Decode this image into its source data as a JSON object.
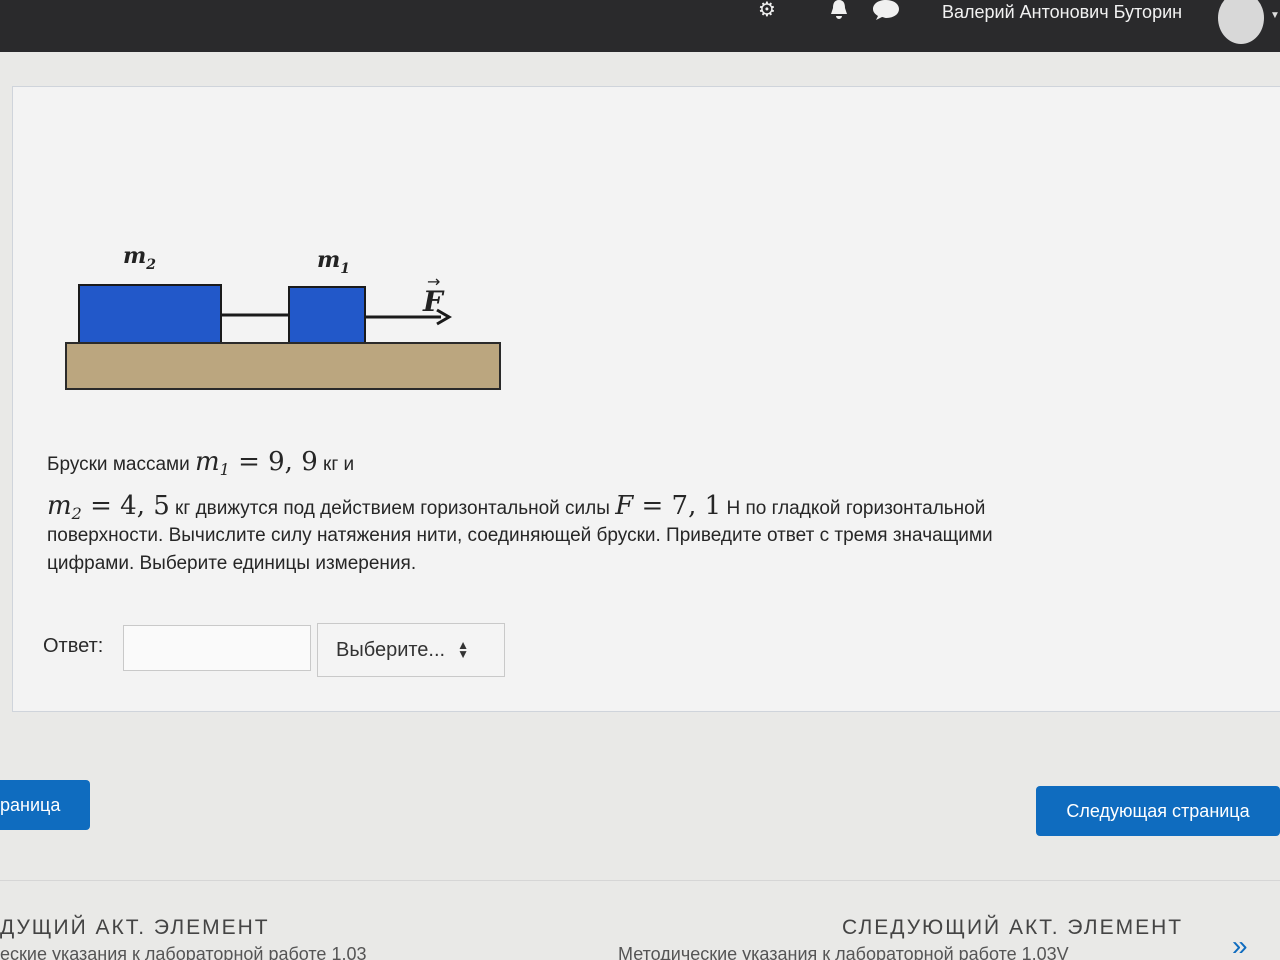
{
  "header": {
    "user_name": "Валерий Антонович Буторин",
    "icons": [
      "settings-icon",
      "bell-icon",
      "chat-icon"
    ]
  },
  "figure": {
    "label_m2_main": "m",
    "label_m2_sub": "2",
    "label_m1_main": "m",
    "label_m1_sub": "1",
    "label_force": "F",
    "label_force_arrow": "→",
    "colors": {
      "block": "#2258c9",
      "surface": "#bba67f"
    }
  },
  "question": {
    "line1_text": "Бруски массами ",
    "line1_math_var": "m",
    "line1_math_sub": "1",
    "line1_math_eq": " = 9, 9",
    "line1_unit": " кг и",
    "line2_math_var": "m",
    "line2_math_sub": "2",
    "line2_math_eq": " = 4, 5",
    "line2_text": " кг движутся под действием горизонтальной силы ",
    "line2_force_var": "F",
    "line2_force_eq": " = 7, 1",
    "line2_tail": " Н по гладкой  горизонтальной",
    "line3": "поверхности.  Вычислите силу натяжения нити, соединяющей бруски. Приведите ответ с тремя значащими",
    "line4": "цифрами. Выберите единицы измерения."
  },
  "answer": {
    "label": "Ответ:",
    "value": "",
    "unit_selected": "Выберите..."
  },
  "navigation": {
    "prev_button": "раница",
    "next_button": "Следующая страница"
  },
  "footer": {
    "prev_activity_heading": "ДУЩИЙ АКТ. ЭЛЕМЕНТ",
    "prev_activity_link": "еские указания к лабораторной работе 1.03",
    "next_activity_heading": "СЛЕДУЮЩИЙ АКТ. ЭЛЕМЕНТ",
    "next_activity_link": "Методические указания к лабораторной работе 1.03V",
    "next_arrow": "»"
  }
}
